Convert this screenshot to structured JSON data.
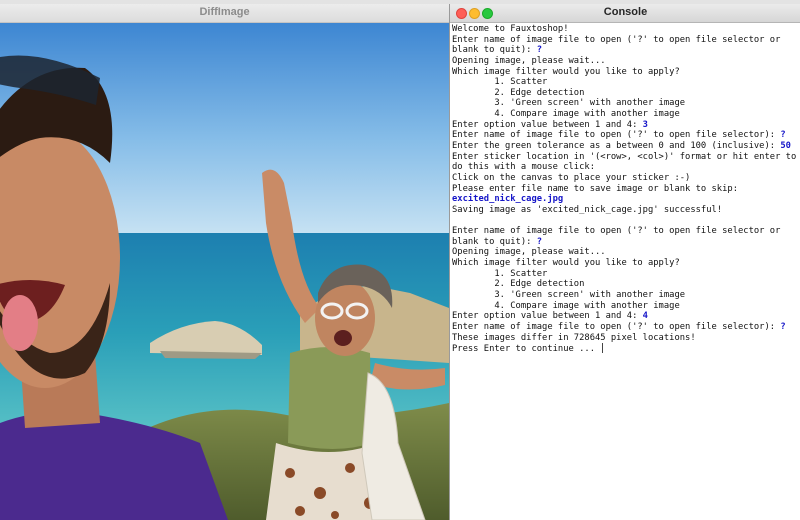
{
  "diff_window": {
    "title": "DiffImage"
  },
  "console_window": {
    "title": "Console",
    "lines": [
      {
        "text": "Welcome to Fauxtoshop!",
        "input": ""
      },
      {
        "text": "Enter name of image file to open ('?' to open file selector or",
        "input": ""
      },
      {
        "text": "blank to quit): ",
        "input": "?"
      },
      {
        "text": "Opening image, please wait...",
        "input": ""
      },
      {
        "text": "Which image filter would you like to apply?",
        "input": ""
      },
      {
        "text": "        1. Scatter",
        "input": ""
      },
      {
        "text": "        2. Edge detection",
        "input": ""
      },
      {
        "text": "        3. 'Green screen' with another image",
        "input": ""
      },
      {
        "text": "        4. Compare image with another image",
        "input": ""
      },
      {
        "text": "Enter option value between 1 and 4: ",
        "input": "3"
      },
      {
        "text": "Enter name of image file to open ('?' to open file selector): ",
        "input": "?"
      },
      {
        "text": "Enter the green tolerance as a between 0 and 100 (inclusive): ",
        "input": "50"
      },
      {
        "text": "Enter sticker location in '(<row>, <col>)' format or hit enter to",
        "input": ""
      },
      {
        "text": "do this with a mouse click:",
        "input": ""
      },
      {
        "text": "Click on the canvas to place your sticker :-)",
        "input": ""
      },
      {
        "text": "Please enter file name to save image or blank to skip:",
        "input": ""
      },
      {
        "text": "",
        "input": "excited_nick_cage.jpg"
      },
      {
        "text": "Saving image as 'excited_nick_cage.jpg' successful!",
        "input": ""
      },
      {
        "text": "",
        "input": ""
      },
      {
        "text": "Enter name of image file to open ('?' to open file selector or",
        "input": ""
      },
      {
        "text": "blank to quit): ",
        "input": "?"
      },
      {
        "text": "Opening image, please wait...",
        "input": ""
      },
      {
        "text": "Which image filter would you like to apply?",
        "input": ""
      },
      {
        "text": "        1. Scatter",
        "input": ""
      },
      {
        "text": "        2. Edge detection",
        "input": ""
      },
      {
        "text": "        3. 'Green screen' with another image",
        "input": ""
      },
      {
        "text": "        4. Compare image with another image",
        "input": ""
      },
      {
        "text": "Enter option value between 1 and 4: ",
        "input": "4"
      },
      {
        "text": "Enter name of image file to open ('?' to open file selector): ",
        "input": "?"
      },
      {
        "text": "These images differ in 728645 pixel locations!",
        "input": ""
      },
      {
        "text": "Press Enter to continue ... ",
        "input": ""
      }
    ]
  },
  "colors": {
    "input_text": "#1515c8",
    "close": "#fe5f57",
    "minimize": "#febc2e",
    "maximize": "#28c840"
  }
}
